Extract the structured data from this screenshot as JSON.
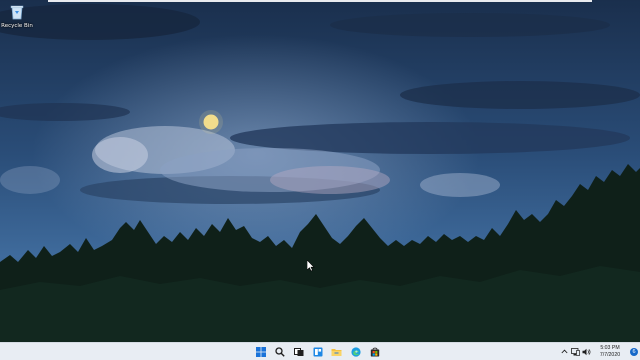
{
  "desktop": {
    "icons": [
      {
        "label": "Recycle Bin",
        "icon": "recycle-bin-icon"
      }
    ],
    "wallpaper": {
      "icon": "moonlit-forest-wallpaper"
    }
  },
  "taskbar": {
    "pinned": [
      {
        "icon": "start-icon",
        "color": "#1a73d9"
      },
      {
        "icon": "search-icon",
        "color": "#1f1f1f"
      },
      {
        "icon": "task-view-icon",
        "color": "#1f1f1f"
      },
      {
        "icon": "widgets-icon",
        "color": "#1e88e5"
      },
      {
        "icon": "file-explorer-icon",
        "color": "#f5c242"
      },
      {
        "icon": "edge-icon",
        "color": "#1b9de2"
      },
      {
        "icon": "store-icon",
        "color": "#2b2b2b"
      }
    ],
    "tray": {
      "icons": [
        "chevron-up-icon",
        "network-icon",
        "volume-icon"
      ],
      "time": "5:03 PM",
      "date": "7/7/2020",
      "notification_count": "6"
    }
  },
  "colors": {
    "accent": "#1769c9",
    "taskbar_bg": "#e8edf3"
  }
}
